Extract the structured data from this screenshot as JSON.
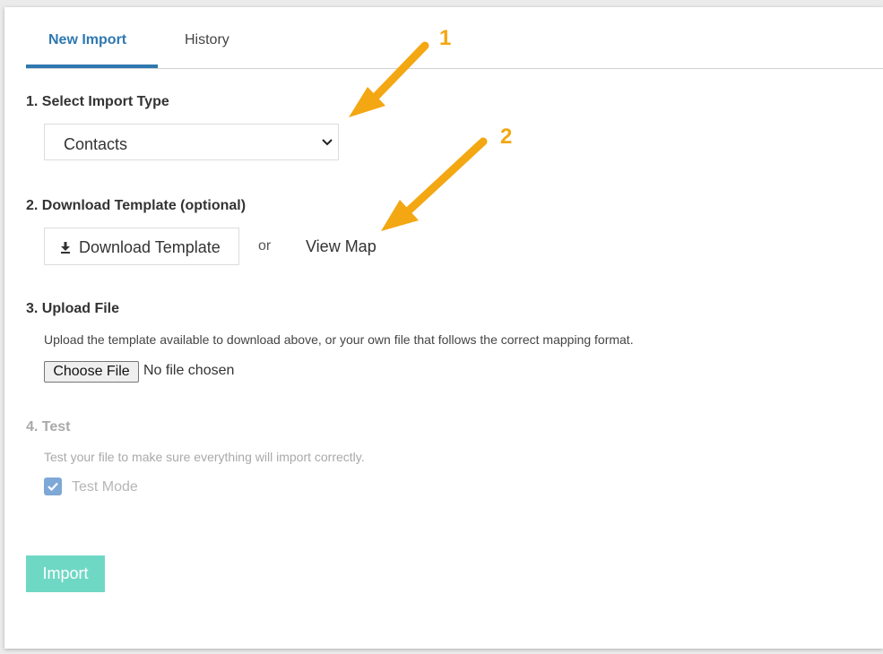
{
  "tabs": [
    {
      "label": "New Import",
      "active": true
    },
    {
      "label": "History",
      "active": false
    }
  ],
  "steps": {
    "select_type": {
      "title": "1. Select Import Type",
      "selected_value": "Contacts"
    },
    "download": {
      "title": "2. Download Template (optional)",
      "button_label": "Download Template",
      "or_text": "or",
      "view_map_label": "View Map"
    },
    "upload": {
      "title": "3. Upload File",
      "description": "Upload the template available to download above, or your own file that follows the correct mapping format.",
      "choose_file_label": "Choose File",
      "no_file_text": "No file chosen"
    },
    "test": {
      "title": "4. Test",
      "description": "Test your file to make sure everything will import correctly.",
      "checkbox_label": "Test Mode",
      "checked": true
    }
  },
  "import_button_label": "Import",
  "annotations": [
    "1",
    "2"
  ],
  "colors": {
    "accent": "#2f78b0",
    "import_button": "#6fd8c5",
    "annotation": "#f3a712"
  },
  "icons": [
    "download-icon",
    "chevron-down-icon",
    "checkmark-icon"
  ]
}
